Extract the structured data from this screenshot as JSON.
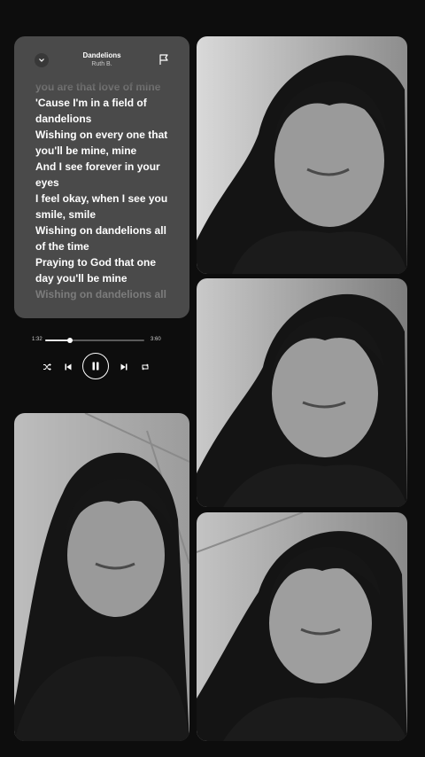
{
  "player": {
    "song_title": "Dandelions",
    "artist": "Ruth B.",
    "lyrics": [
      "you are that love of mine",
      "'Cause I'm in a field of",
      "dandelions",
      "Wishing on every one that",
      "you'll be mine, mine",
      "And I see forever in your",
      "eyes",
      "I feel okay, when I see you",
      "smile, smile",
      "Wishing on dandelions all",
      "of the time",
      "Praying to God that one",
      "day you'll be mine",
      "Wishing on dandelions all"
    ],
    "elapsed": "1:32",
    "duration": "3:60",
    "progress_fraction": 0.25,
    "icons": {
      "collapse": "chevron-down-icon",
      "flag": "flag-icon",
      "shuffle": "shuffle-icon",
      "previous": "previous-icon",
      "pause": "pause-icon",
      "next": "next-icon",
      "repeat": "repeat-icon"
    }
  },
  "colors": {
    "background": "#0d0d0d",
    "lyrics_card": "#4a4a4a",
    "lyric_active": "#ffffff",
    "lyric_faded": "#7c7c7c"
  }
}
